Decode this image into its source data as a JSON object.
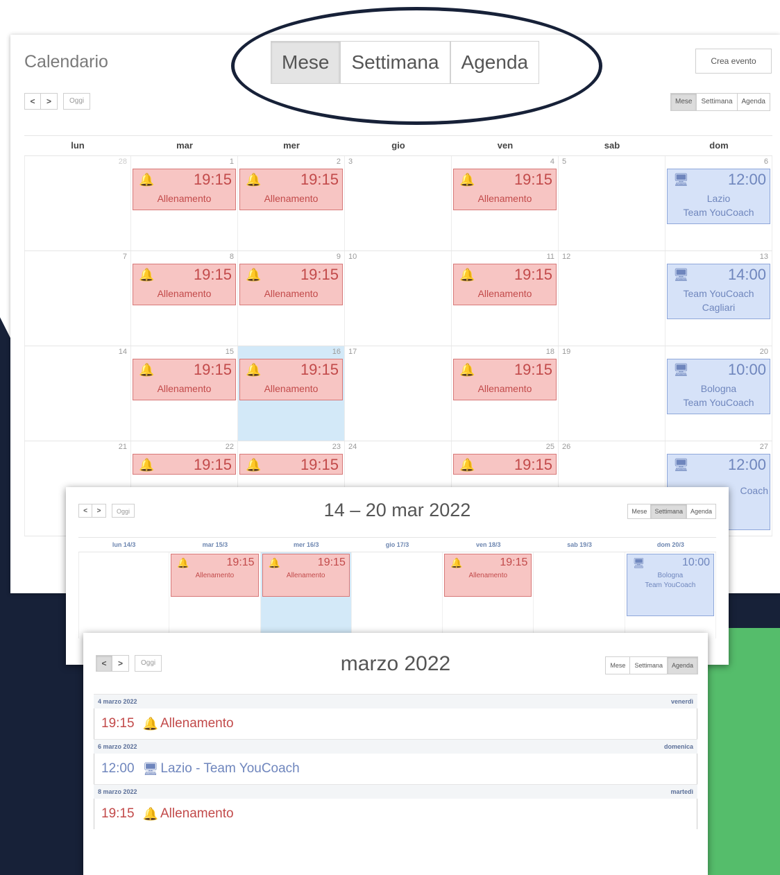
{
  "app": {
    "title": "Calendario",
    "create_button": "Crea evento"
  },
  "view_switch": {
    "month": "Mese",
    "week": "Settimana",
    "agenda": "Agenda",
    "active": "Mese"
  },
  "nav": {
    "prev": "<",
    "next": ">",
    "today": "Oggi"
  },
  "month_view": {
    "days_of_week": [
      "lun",
      "mar",
      "mer",
      "gio",
      "ven",
      "sab",
      "dom"
    ],
    "weeks": [
      [
        "28",
        "1",
        "2",
        "3",
        "4",
        "5",
        "6"
      ],
      [
        "7",
        "8",
        "9",
        "10",
        "11",
        "12",
        "13"
      ],
      [
        "14",
        "15",
        "16",
        "17",
        "18",
        "19",
        "20"
      ],
      [
        "21",
        "22",
        "23",
        "24",
        "25",
        "26",
        "27"
      ]
    ],
    "today": "16",
    "events": {
      "training": {
        "time": "19:15",
        "title": "Allenamento",
        "icon": "bell-icon",
        "color": "#c24a4a"
      },
      "match1": {
        "time": "12:00",
        "title": "Lazio\nTeam YouCoach",
        "icon": "monitor-icon"
      },
      "match2": {
        "time": "14:00",
        "title": "Team YouCoach\nCagliari",
        "icon": "monitor-icon"
      },
      "match3": {
        "time": "10:00",
        "title": "Bologna\nTeam YouCoach",
        "icon": "monitor-icon"
      },
      "match4": {
        "time": "12:00",
        "title": "Coach",
        "icon": "monitor-icon"
      },
      "next_week_partial": {
        "time": "12:00"
      }
    }
  },
  "week_view": {
    "title": "14 – 20 mar 2022",
    "days_of_week": [
      "lun 14/3",
      "mar 15/3",
      "mer 16/3",
      "gio 17/3",
      "ven 18/3",
      "sab 19/3",
      "dom 20/3"
    ],
    "training": {
      "time": "19:15",
      "title": "Allenamento"
    },
    "match": {
      "time": "10:00",
      "title": "Bologna\nTeam YouCoach"
    }
  },
  "agenda_view": {
    "title": "marzo 2022",
    "entries": [
      {
        "date": "4 marzo 2022",
        "weekday": "venerdì",
        "time": "19:15",
        "title": "Allenamento",
        "kind": "training"
      },
      {
        "date": "6 marzo 2022",
        "weekday": "domenica",
        "time": "12:00",
        "title": "Lazio - Team YouCoach",
        "kind": "match"
      },
      {
        "date": "8 marzo 2022",
        "weekday": "martedì",
        "time": "19:15",
        "title": "Allenamento",
        "kind": "training"
      }
    ]
  },
  "colors": {
    "navy": "#172138",
    "green": "#55bd6b",
    "event_red_bg": "#f7c5c3",
    "event_blue_bg": "#d6e2f8",
    "today_bg": "#d3e9f8"
  }
}
